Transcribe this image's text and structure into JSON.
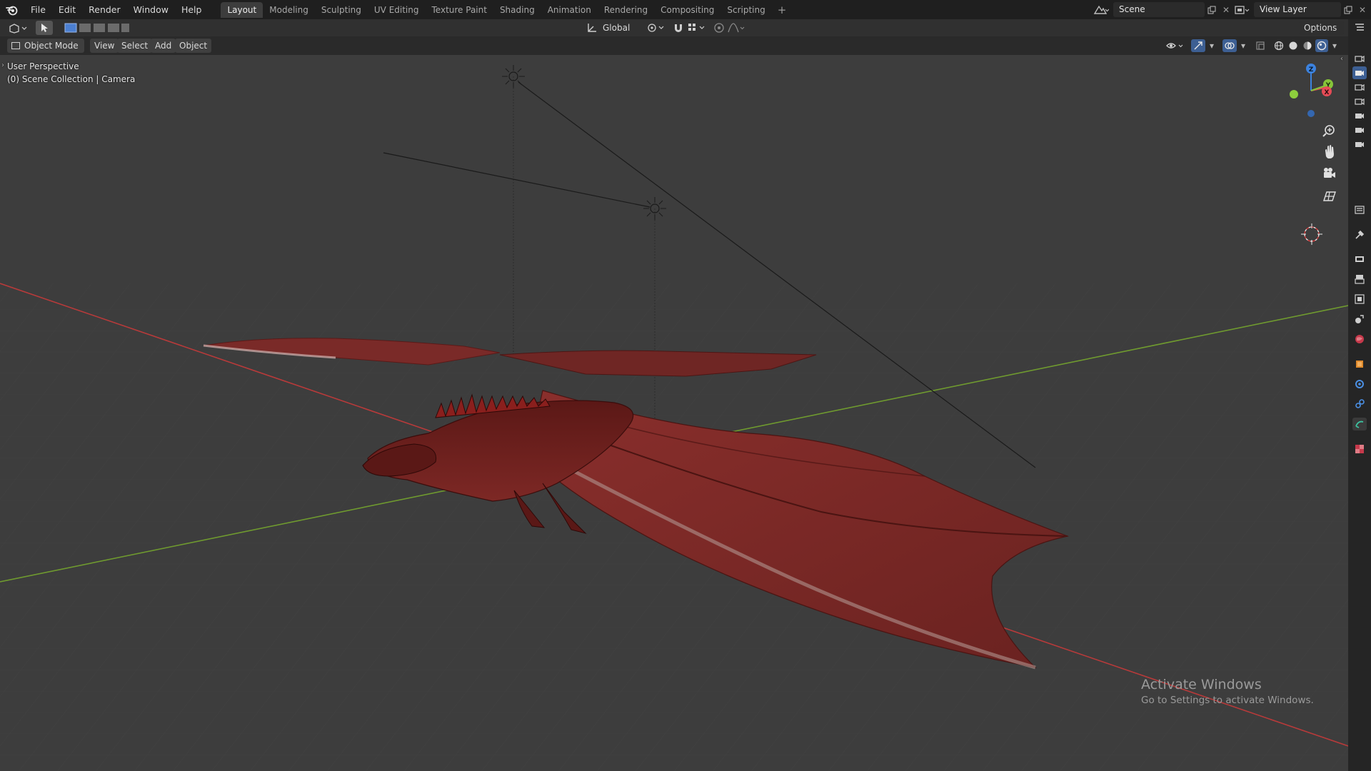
{
  "menu": {
    "items": [
      "File",
      "Edit",
      "Render",
      "Window",
      "Help"
    ]
  },
  "workspaces": {
    "tabs": [
      "Layout",
      "Modeling",
      "Sculpting",
      "UV Editing",
      "Texture Paint",
      "Shading",
      "Animation",
      "Rendering",
      "Compositing",
      "Scripting"
    ],
    "active": "Layout",
    "add_symbol": "+"
  },
  "scene": {
    "name": "Scene",
    "view_layer": "View Layer"
  },
  "header": {
    "transform_orientation": "Global",
    "options_label": "Options"
  },
  "toolheader": {
    "mode": "Object Mode",
    "menus": [
      "View",
      "Select",
      "Add",
      "Object"
    ]
  },
  "viewport": {
    "perspective_label": "User Perspective",
    "collection_label": "(0) Scene Collection | Camera",
    "gizmo_axes": {
      "z": "Z",
      "y": "Y",
      "x": "X"
    }
  },
  "watermark": {
    "title": "Activate Windows",
    "subtitle": "Go to Settings to activate Windows."
  },
  "colors": {
    "x_axis": "#b83a3a",
    "y_axis": "#6f9a2f",
    "dragon": "#7a2826",
    "gizmo_x": "#e64b56",
    "gizmo_y": "#86c439",
    "gizmo_z": "#3c83e0"
  }
}
